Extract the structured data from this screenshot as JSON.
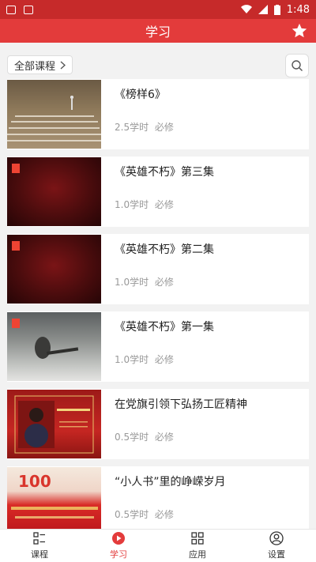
{
  "status": {
    "time": "1:48"
  },
  "header": {
    "title": "学习"
  },
  "filter": {
    "label": "全部课程"
  },
  "courses": [
    {
      "title": "《榜样6》",
      "hours": "2.5学时",
      "type": "必修"
    },
    {
      "title": "《英雄不朽》第三集",
      "hours": "1.0学时",
      "type": "必修"
    },
    {
      "title": "《英雄不朽》第二集",
      "hours": "1.0学时",
      "type": "必修"
    },
    {
      "title": "《英雄不朽》第一集",
      "hours": "1.0学时",
      "type": "必修"
    },
    {
      "title": "在党旗引领下弘扬工匠精神",
      "hours": "0.5学时",
      "type": "必修"
    },
    {
      "title": "“小人书”里的峥嵘岁月",
      "hours": "0.5学时",
      "type": "必修"
    }
  ],
  "tabs": [
    {
      "label": "课程",
      "icon": "list-icon"
    },
    {
      "label": "学习",
      "icon": "play-icon"
    },
    {
      "label": "应用",
      "icon": "grid-icon"
    },
    {
      "label": "设置",
      "icon": "user-icon"
    }
  ],
  "colors": {
    "primary": "#e33b3b",
    "status_bar": "#c62a2a"
  }
}
